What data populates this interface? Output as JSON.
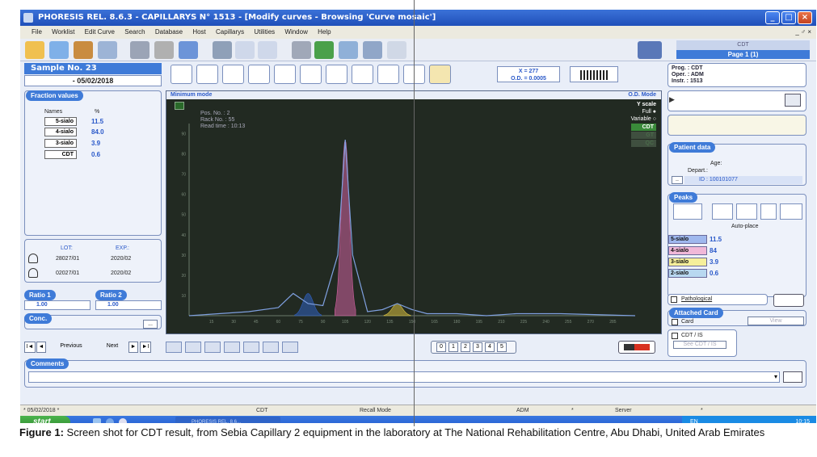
{
  "window": {
    "title": "PHORESIS REL. 8.6.3 - CAPILLARYS N° 1513 - [Modify curves - Browsing 'Curve mosaic']",
    "menu": [
      "File",
      "Worklist",
      "Edit Curve",
      "Search",
      "Database",
      "Host",
      "Capillarys",
      "Utilities",
      "Window",
      "Help"
    ],
    "menu_right": "_ ♂ ×",
    "minimize": "_",
    "maximize": "□",
    "close": "×"
  },
  "page_indicator": {
    "label": "CDT",
    "page": "Page 1 (1)"
  },
  "sample": {
    "label": "Sample No. 23",
    "date": "- 05/02/2018"
  },
  "readout": {
    "x": "X = 277",
    "od": "O.D. = 0.0005"
  },
  "prog": {
    "prog": "Prog. : CDT",
    "oper": "Oper. : ADM",
    "instr": "Instr. : 1513"
  },
  "fractions": {
    "header": "Fraction values",
    "names_label": "Names",
    "pct_label": "%",
    "rows": [
      {
        "name": "5-sialo",
        "value": "11.5"
      },
      {
        "name": "4-sialo",
        "value": "84.0"
      },
      {
        "name": "3-sialo",
        "value": "3.9"
      },
      {
        "name": "CDT",
        "value": "0.6"
      }
    ]
  },
  "lots": {
    "lot_label": "LOT:",
    "exp_label": "EXP.:",
    "rows": [
      {
        "lot": "28027/01",
        "exp": "2020/02"
      },
      {
        "lot": "02027/01",
        "exp": "2020/02"
      }
    ]
  },
  "ratio1": {
    "label": "Ratio 1",
    "value": "1.00"
  },
  "ratio2": {
    "label": "Ratio 2",
    "value": "1.00"
  },
  "conc": {
    "label": "Conc.",
    "button": "..."
  },
  "nav": {
    "first": "I◄",
    "prev_icon": "◄",
    "previous": "Previous",
    "next": "Next",
    "next_icon": "►",
    "last": "►I"
  },
  "pages": [
    "0",
    "1",
    "2",
    "3",
    "4",
    "5"
  ],
  "comments": {
    "label": "Comments"
  },
  "chart": {
    "mode": "Minimum mode",
    "od_mode": "O.D. Mode",
    "yscale": "Y scale",
    "full": "Full ●",
    "variable": "Variable ○",
    "pos": "Pos. No. : 2",
    "rack": "Rack No. : 55",
    "read_time": "Read time : 10:13",
    "badge1": "CDT",
    "badge2": "GT",
    "badge3": "QC"
  },
  "chart_data": {
    "type": "line",
    "title": "",
    "xlabel": "",
    "ylabel": "",
    "x_ticks": [
      15,
      30,
      45,
      60,
      75,
      90,
      105,
      120,
      135,
      150,
      165,
      180,
      195,
      210,
      225,
      240,
      255,
      270,
      285
    ],
    "y_ticks": [
      10,
      20,
      30,
      40,
      50,
      60,
      70,
      80,
      90
    ],
    "series": [
      {
        "x": [
          0,
          20,
          40,
          60,
          70,
          80,
          90,
          100,
          105,
          110,
          120,
          130,
          140,
          150,
          160,
          180,
          200,
          220,
          250,
          300
        ],
        "y": [
          0,
          1,
          2,
          4,
          11,
          6,
          5,
          30,
          87,
          30,
          2,
          3,
          6,
          3,
          1,
          1,
          0,
          1,
          1,
          0
        ]
      }
    ],
    "peaks": [
      {
        "name": "2-sialo",
        "x": 80,
        "y": 11,
        "color": "#3060c0"
      },
      {
        "name": "4-sialo",
        "x": 105,
        "y": 87,
        "color": "#d060a0"
      },
      {
        "name": "3-sialo",
        "x": 140,
        "y": 6,
        "color": "#d8c040"
      }
    ]
  },
  "patient": {
    "header": "Patient data",
    "age": "Age:",
    "depart": "Depart.:",
    "id": "ID : 100101077"
  },
  "peaks_panel": {
    "header": "Peaks",
    "auto_place": "Auto-place",
    "rows": [
      {
        "name": "5-sialo",
        "value": "11.5",
        "color": "#9fb8ee"
      },
      {
        "name": "4-sialo",
        "value": "84",
        "color": "#f0b8d8"
      },
      {
        "name": "3-sialo",
        "value": "3.9",
        "color": "#f6ef9a"
      },
      {
        "name": "2-sialo",
        "value": "0.6",
        "color": "#b8d8f0"
      }
    ]
  },
  "options": {
    "pathological": "Pathological",
    "attached_card": "Attached Card",
    "card": "Card",
    "view": "View",
    "cdt_is": "CDT / IS",
    "see_cdt_is": "See CDT / IS"
  },
  "status_bar": [
    "* 05/02/2018 *",
    "CDT",
    "Recall Mode",
    "ADM",
    "*",
    "Server",
    "*"
  ],
  "taskbar": {
    "start": "start",
    "task": "PHORESIS REL. 8.6...",
    "lang": "EN",
    "time": "10:15"
  },
  "caption": {
    "label": "Figure 1:",
    "text": " Screen shot for CDT result, from Sebia Capillary 2 equipment in the laboratory at The National Rehabilitation Centre, Abu Dhabi, United Arab Emirates"
  }
}
